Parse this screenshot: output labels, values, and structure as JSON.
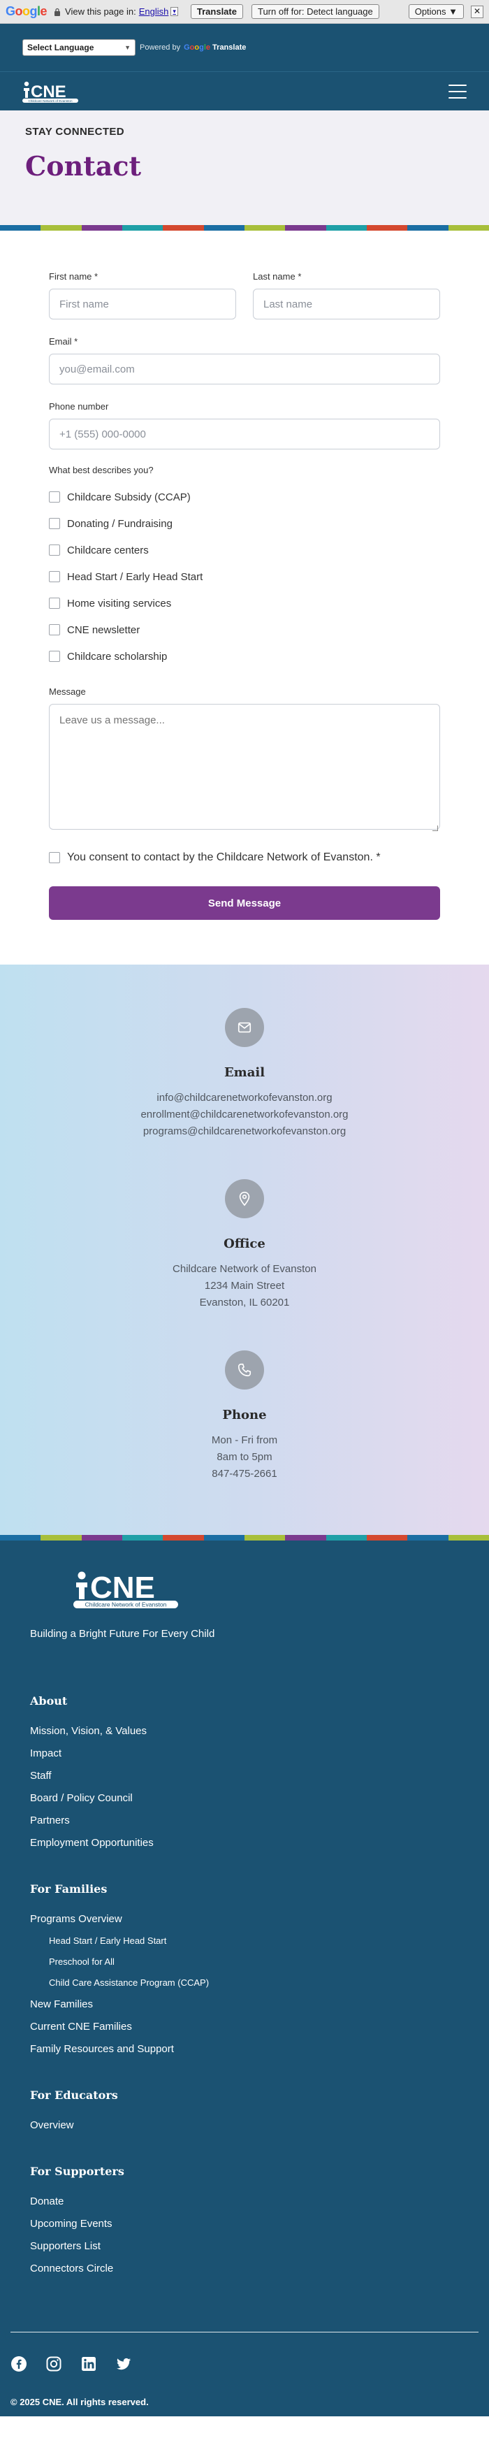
{
  "translate_bar": {
    "logo": [
      "G",
      "o",
      "o",
      "g",
      "l",
      "e"
    ],
    "prompt": "View this page in:",
    "language": "English",
    "translate_button": "Translate",
    "turn_off_button": "Turn off for: Detect language",
    "options_button": "Options ▼",
    "close": "✕"
  },
  "language_bar": {
    "select_value": "Select Language",
    "powered_by": "Powered by",
    "google": [
      "G",
      "o",
      "o",
      "g",
      "l",
      "e"
    ],
    "translate": "Translate"
  },
  "header": {
    "logo_text": "CNE",
    "logo_subtext": "Childcare Network of Evanston"
  },
  "hero": {
    "eyebrow": "STAY CONNECTED",
    "title": "Contact"
  },
  "stripe_colors": [
    "#1b6ea3",
    "#a8bf3a",
    "#7b3a8e",
    "#1fa0a7",
    "#d4482f",
    "#1b6ea3",
    "#a8bf3a",
    "#7b3a8e",
    "#1fa0a7",
    "#d4482f",
    "#1b6ea3",
    "#a8bf3a"
  ],
  "form": {
    "first_name_label": "First name *",
    "first_name_placeholder": "First name",
    "last_name_label": "Last name *",
    "last_name_placeholder": "Last name",
    "email_label": "Email *",
    "email_placeholder": "you@email.com",
    "phone_label": "Phone number",
    "phone_placeholder": "+1 (555) 000-0000",
    "describes_label": "What best describes you?",
    "options": [
      "Childcare Subsidy (CCAP)",
      "Donating / Fundraising",
      "Childcare centers",
      "Head Start / Early Head Start",
      "Home visiting services",
      "CNE newsletter",
      "Childcare scholarship"
    ],
    "message_label": "Message",
    "message_placeholder": "Leave us a message...",
    "consent": "You consent to contact by the Childcare Network of Evanston. *",
    "submit": "Send Message"
  },
  "contact_info": {
    "email": {
      "title": "Email",
      "lines": [
        "info@childcarenetworkofevanston.org",
        "enrollment@childcarenetworkofevanston.org",
        "programs@childcarenetworkofevanston.org"
      ]
    },
    "office": {
      "title": "Office",
      "lines": [
        "Childcare Network of Evanston",
        "1234 Main Street",
        "Evanston, IL 60201"
      ]
    },
    "phone": {
      "title": "Phone",
      "lines": [
        "Mon - Fri from",
        "8am to 5pm",
        "847-475-2661"
      ]
    }
  },
  "footer": {
    "logo_text": "CNE",
    "logo_subtext": "Childcare Network of Evanston",
    "tagline": "Building a Bright Future For Every Child",
    "about": {
      "heading": "About",
      "links": [
        "Mission, Vision, & Values",
        "Impact",
        "Staff",
        "Board / Policy Council",
        "Partners",
        "Employment Opportunities"
      ]
    },
    "families": {
      "heading": "For Families",
      "overview": "Programs Overview",
      "sublinks": [
        "Head Start / Early Head Start",
        "Preschool for All",
        "Child Care Assistance Program (CCAP)"
      ],
      "links": [
        "New Families",
        "Current CNE Families",
        "Family Resources and Support"
      ]
    },
    "educators": {
      "heading": "For Educators",
      "links": [
        "Overview"
      ]
    },
    "supporters": {
      "heading": "For Supporters",
      "links": [
        "Donate",
        "Upcoming Events",
        "Supporters List",
        "Connectors Circle"
      ]
    },
    "social_icons": [
      "facebook-icon",
      "instagram-icon",
      "linkedin-icon",
      "twitter-icon"
    ],
    "copyright": "© 2025 CNE. All rights reserved."
  }
}
